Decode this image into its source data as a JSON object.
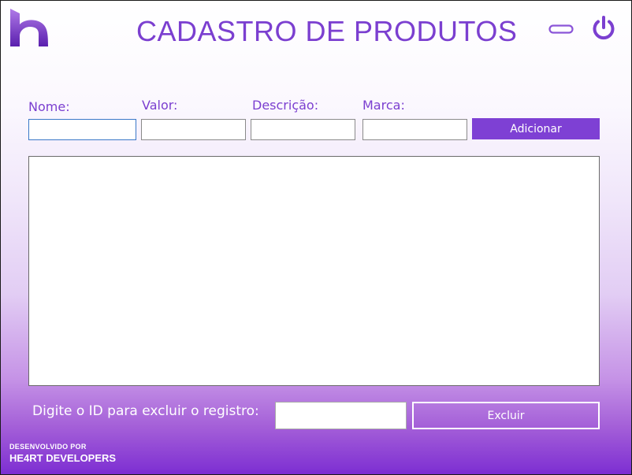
{
  "header": {
    "title": "CADASTRO DE PRODUTOS",
    "logo_icon": "brand-h-logo-icon",
    "minimize_icon": "minimize-icon",
    "power_icon": "power-icon"
  },
  "form": {
    "nome_label": "Nome:",
    "valor_label": "Valor:",
    "descricao_label": "Descrição:",
    "marca_label": "Marca:",
    "nome_value": "",
    "valor_value": "",
    "descricao_value": "",
    "marca_value": "",
    "add_button": "Adicionar"
  },
  "delete": {
    "label": "Digite o ID para excluir o registro:",
    "id_value": "",
    "button": "Excluir"
  },
  "footer": {
    "line1": "DESENVOLVIDO POR",
    "line2": "HE4RT DEVELOPERS"
  },
  "colors": {
    "accent": "#7e40d4",
    "title": "#7b3fd0",
    "gradient_bottom": "#7d2ed2"
  }
}
